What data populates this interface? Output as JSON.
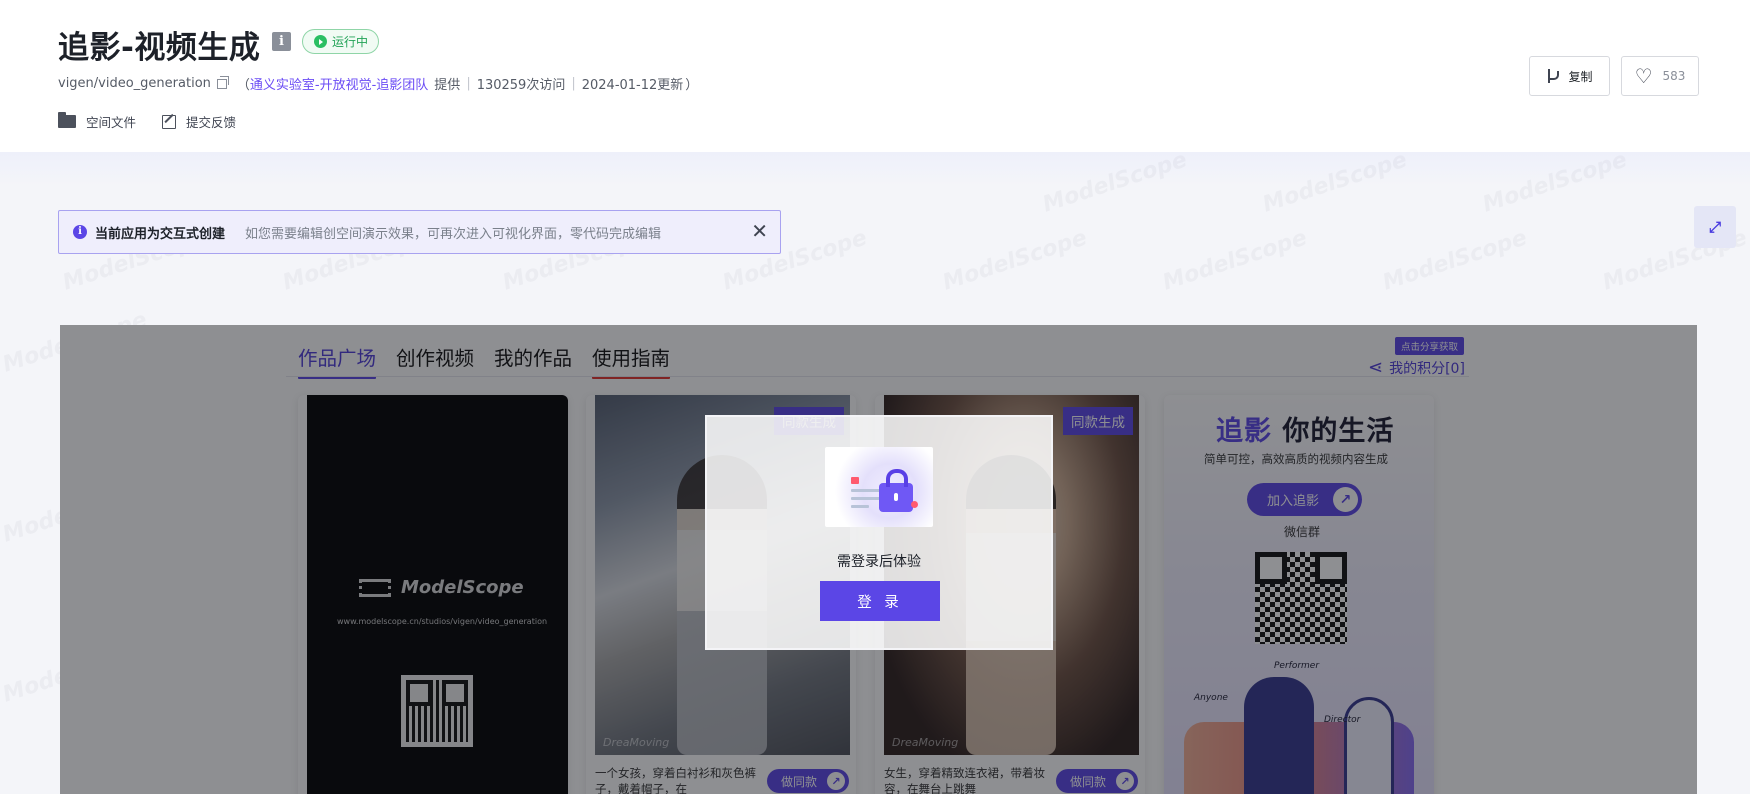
{
  "header": {
    "title": "追影-视频生成",
    "status_badge": "运行中",
    "repo_path": "vigen/video_generation",
    "open_paren": "（",
    "org_link": "通义实验室-开放视觉-追影团队",
    "provided_by": "提供",
    "visits": "130259次访问",
    "updated": "2024-01-12更新",
    "close_paren": "）",
    "sep": "|",
    "space_files": "空间文件",
    "feedback": "提交反馈",
    "copy_btn": "复制",
    "like_count": "583"
  },
  "notice": {
    "title": "当前应用为交互式创建",
    "description": "如您需要编辑创空间演示效果，可再次进入可视化界面，零代码完成编辑",
    "close": "✕"
  },
  "app": {
    "tabs": [
      {
        "label": "作品广场"
      },
      {
        "label": "创作视频"
      },
      {
        "label": "我的作品"
      },
      {
        "label": "使用指南"
      }
    ],
    "tip_badge": "点击分享获取",
    "points_label": "我的积分[0]",
    "card1": {
      "logo_text": "ModelScope",
      "url": "www.modelscope.cn/studios/vigen/video_generation"
    },
    "card2": {
      "tag": "同款生成",
      "watermark": "DreaMoving",
      "caption": "一个女孩，穿着白衬衫和灰色裤子，戴着帽子，在",
      "same_btn": "做同款"
    },
    "card3": {
      "tag": "同款生成",
      "watermark": "DreaMoving",
      "caption": "女生，穿着精致连衣裙，带着妆容，在舞台上跳舞",
      "same_btn": "做同款"
    },
    "card4": {
      "title_highlight": "追影",
      "title_rest": " 你的生活",
      "subtitle": "简单可控，高效高质的视频内容生成",
      "join_btn": "加入追影",
      "wechat_group": "微信群",
      "illus_labels": [
        "Performer",
        "Anyone",
        "Director"
      ]
    }
  },
  "modal": {
    "message": "需登录后体验",
    "login_btn": "登 录"
  },
  "watermark_text": "ModelScope",
  "colors": {
    "accent": "#5b46e6",
    "status_green": "#22a357",
    "link": "#6b4cf5"
  }
}
